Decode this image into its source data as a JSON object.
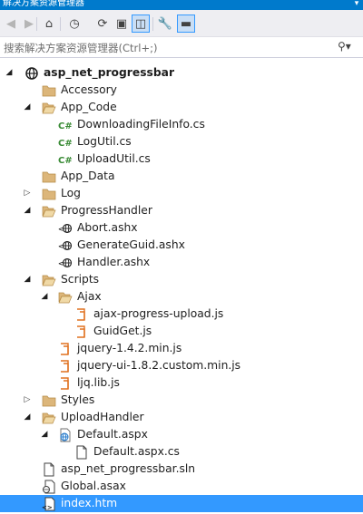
{
  "window": {
    "title": "解决方案资源管理器",
    "pin_glyph": "▾"
  },
  "toolbar": {
    "buttons": [
      {
        "name": "back-icon",
        "glyph": "◀"
      },
      {
        "name": "forward-icon",
        "glyph": "▶"
      },
      {
        "name": "home-icon",
        "glyph": "⌂"
      },
      {
        "name": "history-icon",
        "glyph": "◷"
      },
      {
        "name": "refresh-icon",
        "glyph": "⟳"
      },
      {
        "name": "collapse-all-icon",
        "glyph": "▣"
      },
      {
        "name": "show-all-files-icon",
        "glyph": "◫"
      },
      {
        "name": "properties-icon",
        "glyph": "🔧"
      },
      {
        "name": "preview-icon",
        "glyph": "▬"
      }
    ]
  },
  "search": {
    "placeholder": "搜索解决方案资源管理器(Ctrl+;)",
    "icon": "search-icon",
    "glyph": "⚲▾"
  },
  "tree": [
    {
      "label": "asp_net_progressbar",
      "depth": 0,
      "expander": "expanded",
      "icon": "project",
      "bold": true
    },
    {
      "label": "Accessory",
      "depth": 1,
      "expander": "none",
      "icon": "folder-closed"
    },
    {
      "label": "App_Code",
      "depth": 1,
      "expander": "expanded",
      "icon": "folder-open"
    },
    {
      "label": "DownloadingFileInfo.cs",
      "depth": 2,
      "expander": "none",
      "icon": "csharp"
    },
    {
      "label": "LogUtil.cs",
      "depth": 2,
      "expander": "none",
      "icon": "csharp"
    },
    {
      "label": "UploadUtil.cs",
      "depth": 2,
      "expander": "none",
      "icon": "csharp"
    },
    {
      "label": "App_Data",
      "depth": 1,
      "expander": "none",
      "icon": "folder-closed"
    },
    {
      "label": "Log",
      "depth": 1,
      "expander": "collapsed",
      "icon": "folder-closed"
    },
    {
      "label": "ProgressHandler",
      "depth": 1,
      "expander": "expanded",
      "icon": "folder-open"
    },
    {
      "label": "Abort.ashx",
      "depth": 2,
      "expander": "none",
      "icon": "web-handler"
    },
    {
      "label": "GenerateGuid.ashx",
      "depth": 2,
      "expander": "none",
      "icon": "web-handler"
    },
    {
      "label": "Handler.ashx",
      "depth": 2,
      "expander": "none",
      "icon": "web-handler"
    },
    {
      "label": "Scripts",
      "depth": 1,
      "expander": "expanded",
      "icon": "folder-open"
    },
    {
      "label": "Ajax",
      "depth": 2,
      "expander": "expanded",
      "icon": "folder-open"
    },
    {
      "label": "ajax-progress-upload.js",
      "depth": 3,
      "expander": "none",
      "icon": "javascript"
    },
    {
      "label": "GuidGet.js",
      "depth": 3,
      "expander": "none",
      "icon": "javascript"
    },
    {
      "label": "jquery-1.4.2.min.js",
      "depth": 2,
      "expander": "none",
      "icon": "javascript"
    },
    {
      "label": "jquery-ui-1.8.2.custom.min.js",
      "depth": 2,
      "expander": "none",
      "icon": "javascript"
    },
    {
      "label": "ljq.lib.js",
      "depth": 2,
      "expander": "none",
      "icon": "javascript"
    },
    {
      "label": "Styles",
      "depth": 1,
      "expander": "collapsed",
      "icon": "folder-closed"
    },
    {
      "label": "UploadHandler",
      "depth": 1,
      "expander": "expanded",
      "icon": "folder-open"
    },
    {
      "label": "Default.aspx",
      "depth": 2,
      "expander": "expanded",
      "icon": "web-form"
    },
    {
      "label": "Default.aspx.cs",
      "depth": 3,
      "expander": "none",
      "icon": "file"
    },
    {
      "label": "asp_net_progressbar.sln",
      "depth": 1,
      "expander": "none",
      "icon": "file"
    },
    {
      "label": "Global.asax",
      "depth": 1,
      "expander": "none",
      "icon": "global"
    },
    {
      "label": "index.htm",
      "depth": 1,
      "expander": "none",
      "icon": "html",
      "selected": true
    }
  ],
  "colors": {
    "accent": "#007acc",
    "selection": "#3399ff",
    "folder": "#dcb67a",
    "csharp": "#388a34",
    "javascript": "#e0701e"
  }
}
